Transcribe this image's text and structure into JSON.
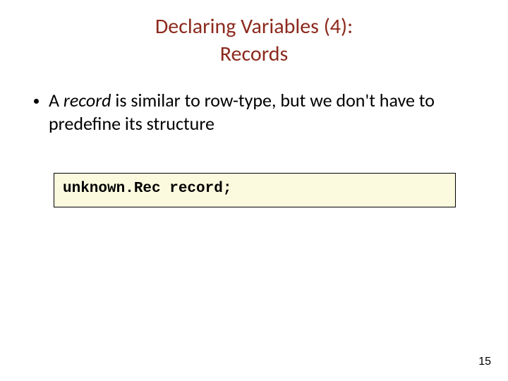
{
  "title": {
    "line1": "Declaring Variables (4):",
    "line2": "Records"
  },
  "bullet": {
    "prefix": "A ",
    "emph": "record",
    "rest": " is similar to row-type, but we don't have to predefine its structure"
  },
  "code": "unknown.Rec record;",
  "page_number": "15"
}
